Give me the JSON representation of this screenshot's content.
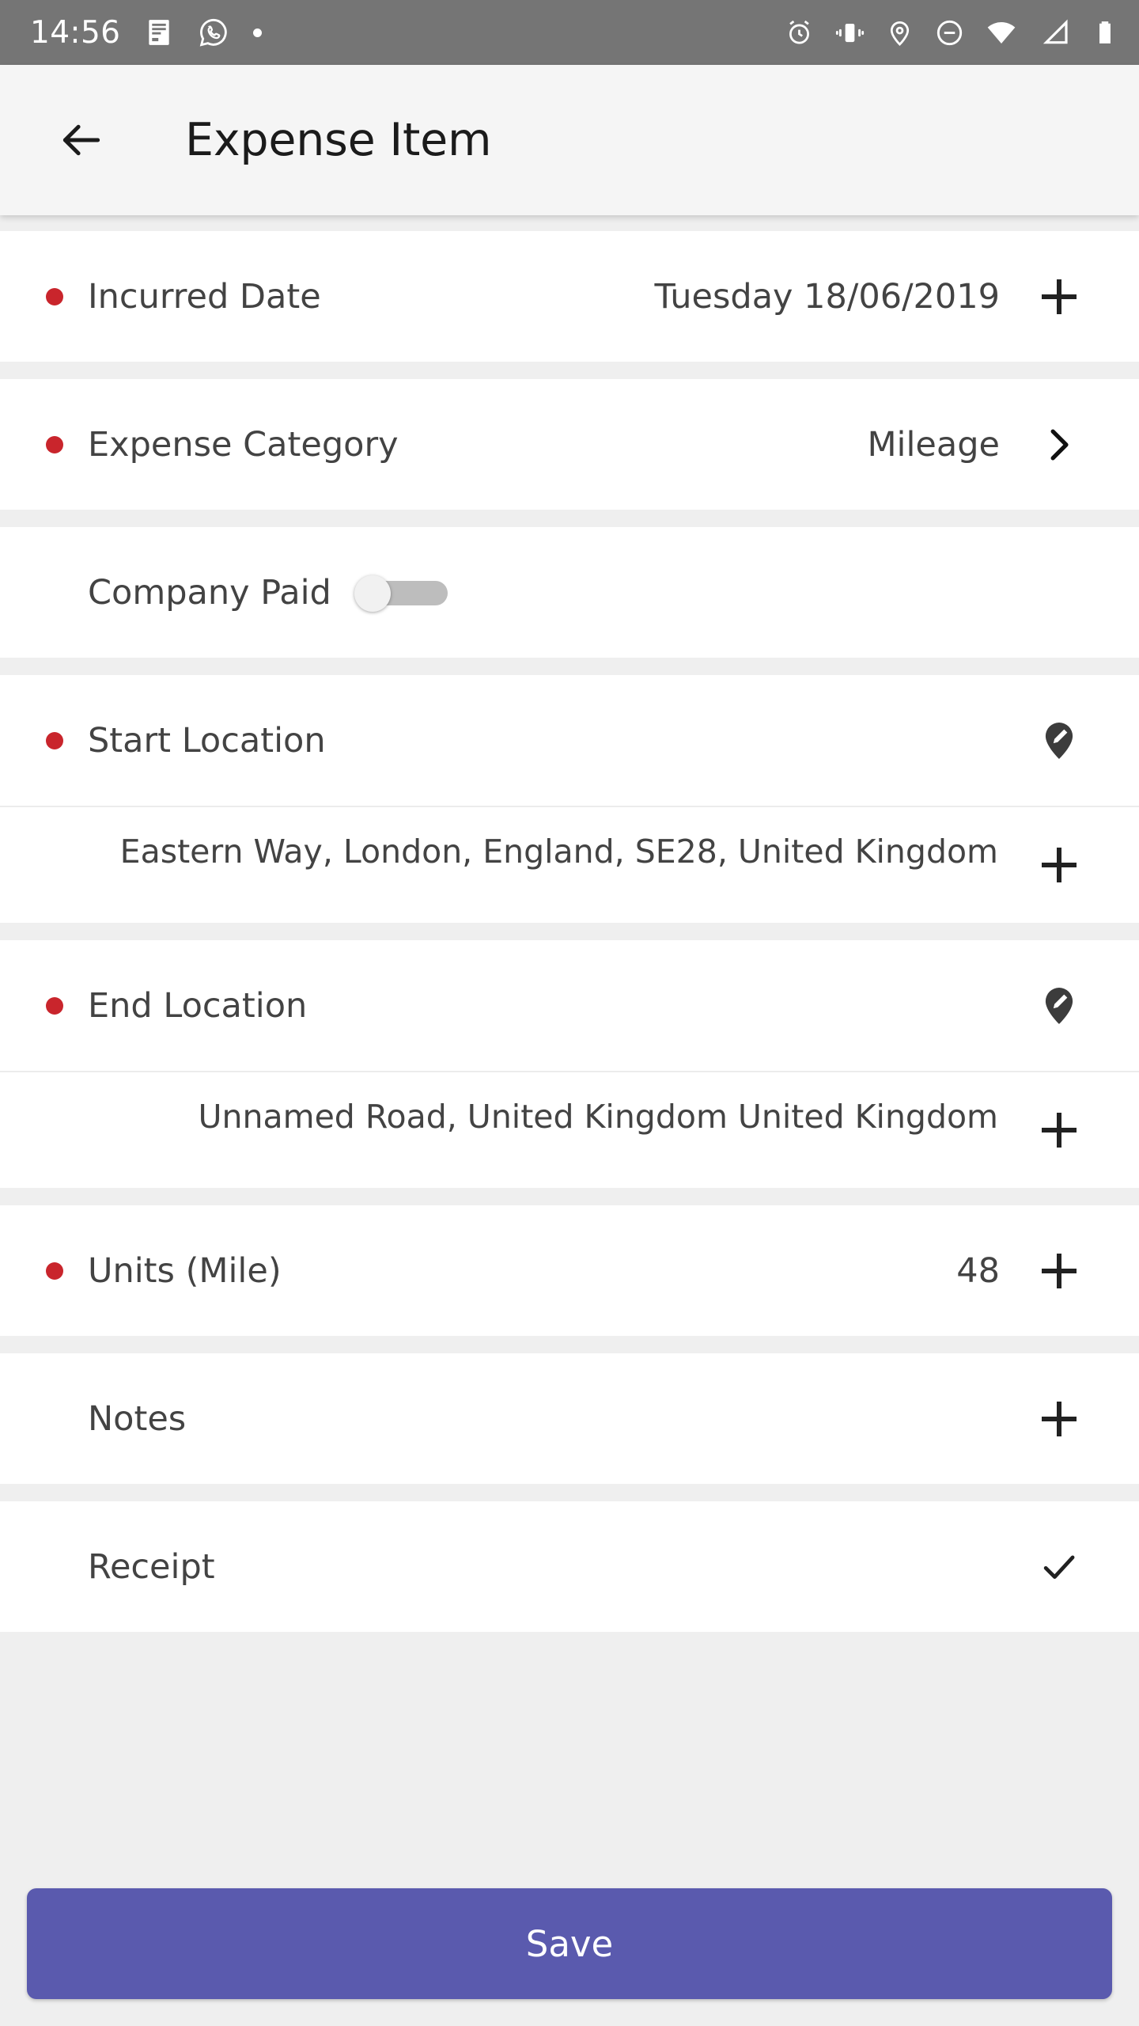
{
  "status_bar": {
    "clock": "14:56",
    "left_icons": [
      "message-icon",
      "whatsapp-icon",
      "dot-icon"
    ],
    "right_icons": [
      "alarm-icon",
      "vibrate-icon",
      "location-icon",
      "do-not-disturb-icon",
      "wifi-icon",
      "signal-icon",
      "battery-icon"
    ],
    "background": "#757575"
  },
  "app_bar": {
    "back_icon": "arrow-back-icon",
    "title": "Expense Item"
  },
  "theme": {
    "required_dot": "#c9252c",
    "save_button": "#5a5aae",
    "text": "#434343",
    "page_background": "#efefef"
  },
  "form": {
    "incurred_date": {
      "label": "Incurred Date",
      "value": "Tuesday 18/06/2019",
      "required": true,
      "action_icon": "plus-icon"
    },
    "expense_category": {
      "label": "Expense Category",
      "value": "Mileage",
      "required": true,
      "action_icon": "chevron-right-icon"
    },
    "company_paid": {
      "label": "Company Paid",
      "required": false,
      "toggle_state": "off",
      "action_icon": "toggle-switch"
    },
    "start_location": {
      "label": "Start Location",
      "required": true,
      "action_icon": "map-pin-edit-icon",
      "address": "Eastern Way, London, England, SE28, United Kingdom",
      "address_action_icon": "plus-icon"
    },
    "end_location": {
      "label": "End Location",
      "required": true,
      "action_icon": "map-pin-edit-icon",
      "address": "Unnamed Road, United Kingdom United Kingdom",
      "address_action_icon": "plus-icon"
    },
    "units": {
      "label": "Units (Mile)",
      "value": "48",
      "required": true,
      "action_icon": "plus-icon"
    },
    "notes": {
      "label": "Notes",
      "required": false,
      "action_icon": "plus-icon"
    },
    "receipt": {
      "label": "Receipt",
      "required": false,
      "action_icon": "check-icon"
    }
  },
  "footer": {
    "save_label": "Save"
  }
}
